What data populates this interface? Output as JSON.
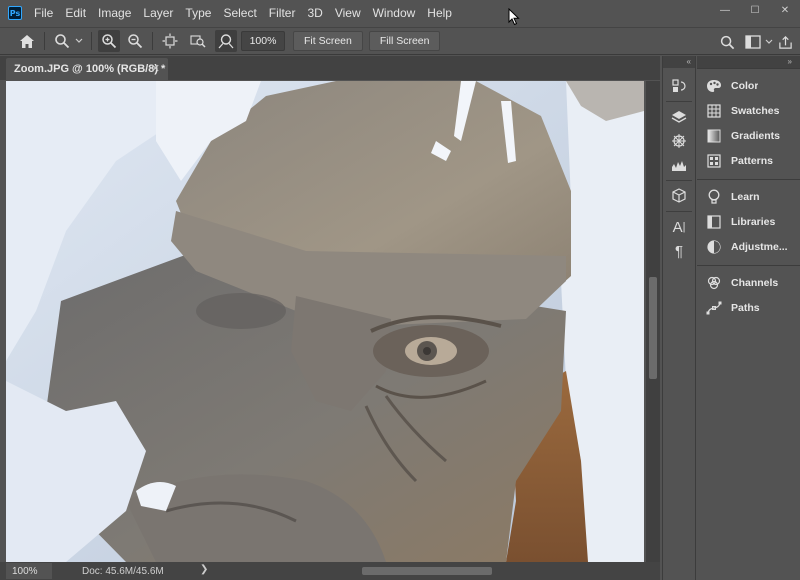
{
  "app": {
    "logo_text": "Ps"
  },
  "menu": [
    "File",
    "Edit",
    "Image",
    "Layer",
    "Type",
    "Select",
    "Filter",
    "3D",
    "View",
    "Window",
    "Help"
  ],
  "window_controls": {
    "minimize": "—",
    "maximize": "☐",
    "close": "✕"
  },
  "options_bar": {
    "zoom_value": "100%",
    "fit_screen_label": "Fit Screen",
    "fill_screen_label": "Fill Screen"
  },
  "document": {
    "tab_title": "Zoom.JPG @ 100% (RGB/8) *",
    "close_glyph": "✕"
  },
  "status": {
    "zoom": "100%",
    "doc_info": "Doc: 45.6M/45.6M",
    "arrow": "❯"
  },
  "panels": {
    "group1": [
      {
        "label": "Color",
        "icon": "palette-icon"
      },
      {
        "label": "Swatches",
        "icon": "grid-icon"
      },
      {
        "label": "Gradients",
        "icon": "gradient-icon"
      },
      {
        "label": "Patterns",
        "icon": "pattern-icon"
      }
    ],
    "group2": [
      {
        "label": "Learn",
        "icon": "bulb-icon"
      },
      {
        "label": "Libraries",
        "icon": "library-icon"
      },
      {
        "label": "Adjustme...",
        "icon": "adjustments-icon"
      }
    ],
    "group3": [
      {
        "label": "Channels",
        "icon": "channels-icon"
      },
      {
        "label": "Paths",
        "icon": "paths-icon"
      }
    ]
  },
  "colors": {
    "ui_bg": "#535353",
    "dark_bg": "#424242",
    "ps_blue": "#31a8ff",
    "snow": "#e8eef6",
    "stone": "#8a8278"
  }
}
